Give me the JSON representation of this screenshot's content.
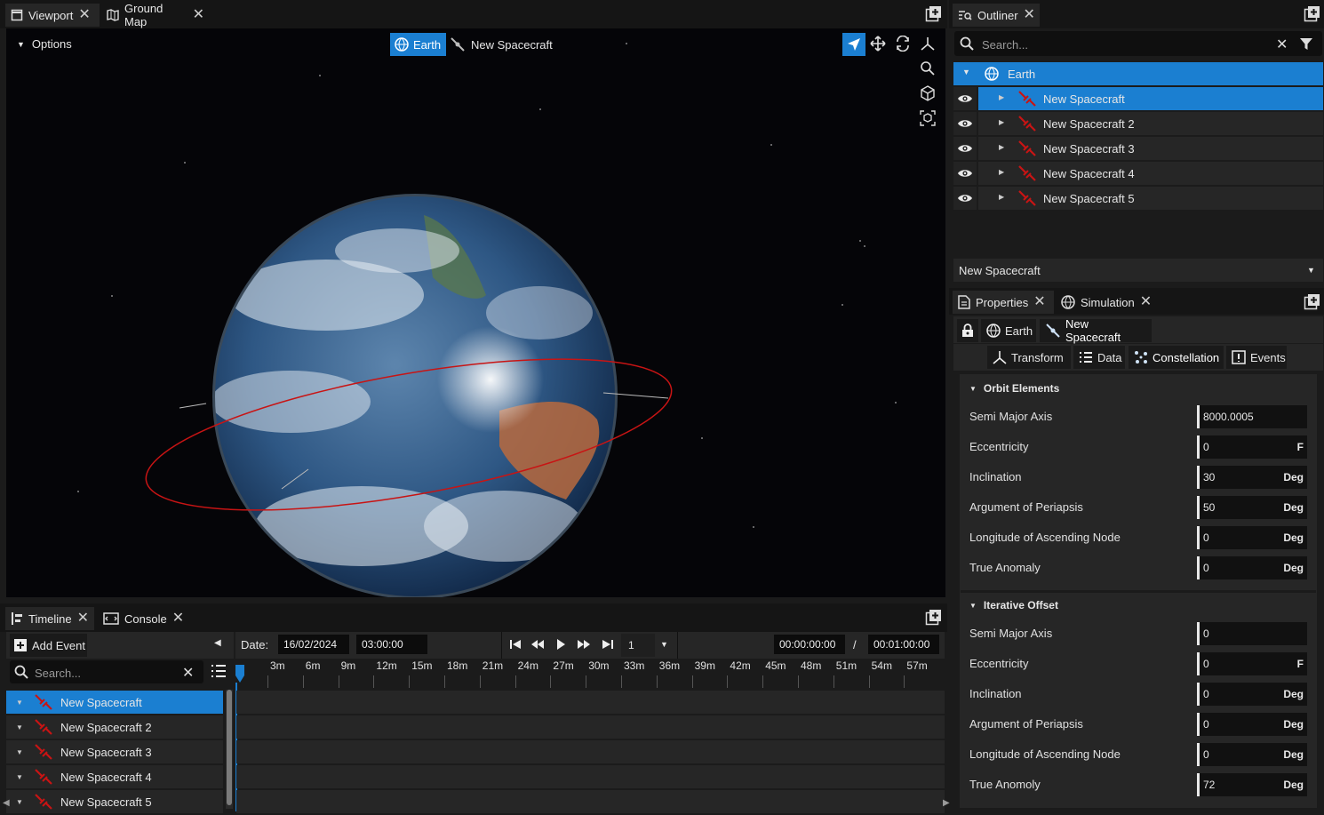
{
  "top_tabs": {
    "viewport": "Viewport",
    "ground_map": "Ground Map"
  },
  "viewport": {
    "options_label": "Options",
    "earth_chip": "Earth",
    "spacecraft_chip": "New Spacecraft"
  },
  "outliner": {
    "tab_label": "Outliner",
    "search_placeholder": "Search...",
    "root": "Earth",
    "items": [
      {
        "label": "New Spacecraft",
        "selected": true
      },
      {
        "label": "New Spacecraft 2",
        "selected": false
      },
      {
        "label": "New Spacecraft 3",
        "selected": false
      },
      {
        "label": "New Spacecraft 4",
        "selected": false
      },
      {
        "label": "New Spacecraft 5",
        "selected": false
      }
    ],
    "dropdown_value": "New Spacecraft"
  },
  "properties": {
    "tab_properties": "Properties",
    "tab_simulation": "Simulation",
    "crumb_earth": "Earth",
    "crumb_spacecraft": "New Spacecraft",
    "subtabs": {
      "transform": "Transform",
      "data": "Data",
      "constellation": "Constellation",
      "events": "Events"
    },
    "orbit_elements": {
      "title": "Orbit Elements",
      "rows": [
        {
          "label": "Semi Major Axis",
          "value": "8000.0005",
          "unit": ""
        },
        {
          "label": "Eccentricity",
          "value": "0",
          "unit": "F"
        },
        {
          "label": "Inclination",
          "value": "30",
          "unit": "Deg"
        },
        {
          "label": "Argument of Periapsis",
          "value": "50",
          "unit": "Deg"
        },
        {
          "label": "Longitude of Ascending Node",
          "value": "0",
          "unit": "Deg"
        },
        {
          "label": "True Anomaly",
          "value": "0",
          "unit": "Deg"
        }
      ]
    },
    "iterative_offset": {
      "title": "Iterative Offset",
      "rows": [
        {
          "label": "Semi Major Axis",
          "value": "0",
          "unit": ""
        },
        {
          "label": "Eccentricity",
          "value": "0",
          "unit": "F"
        },
        {
          "label": "Inclination",
          "value": "0",
          "unit": "Deg"
        },
        {
          "label": "Argument of Periapsis",
          "value": "0",
          "unit": "Deg"
        },
        {
          "label": "Longitude of Ascending Node",
          "value": "0",
          "unit": "Deg"
        },
        {
          "label": "True Anomoly",
          "value": "72",
          "unit": "Deg"
        }
      ]
    }
  },
  "timeline": {
    "tab_timeline": "Timeline",
    "tab_console": "Console",
    "add_event": "Add Event",
    "search_placeholder": "Search...",
    "date_label": "Date:",
    "date_value": "16/02/2024",
    "time_value": "03:00:00",
    "speed_value": "1",
    "elapsed": "00:00:00:00",
    "separator": "/",
    "duration": "00:01:00:00",
    "ticks": [
      "3m",
      "6m",
      "9m",
      "12m",
      "15m",
      "18m",
      "21m",
      "24m",
      "27m",
      "30m",
      "33m",
      "36m",
      "39m",
      "42m",
      "45m",
      "48m",
      "51m",
      "54m",
      "57m"
    ],
    "items": [
      {
        "label": "New Spacecraft",
        "selected": true
      },
      {
        "label": "New Spacecraft 2",
        "selected": false
      },
      {
        "label": "New Spacecraft 3",
        "selected": false
      },
      {
        "label": "New Spacecraft 4",
        "selected": false
      },
      {
        "label": "New Spacecraft 5",
        "selected": false
      }
    ]
  },
  "colors": {
    "accent": "#1b7fd1",
    "orbit": "#c81414",
    "panel": "#262626"
  }
}
